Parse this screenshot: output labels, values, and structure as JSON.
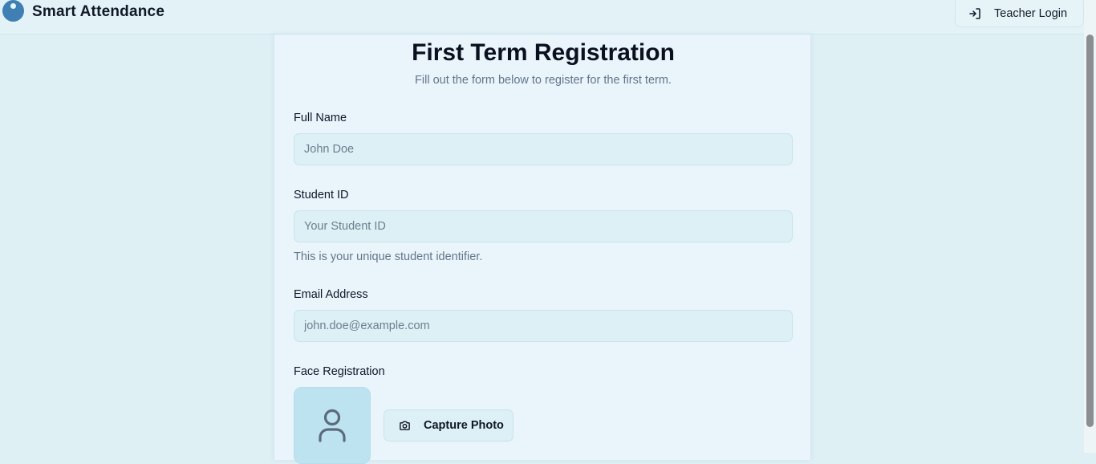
{
  "header": {
    "app_title": "Smart Attendance",
    "logo_icon": "user-circle-logo",
    "login_button": {
      "label": "Teacher Login",
      "icon": "login-arrow-icon"
    }
  },
  "form": {
    "title": "First Term Registration",
    "subtitle": "Fill out the form below to register for the first term.",
    "full_name": {
      "label": "Full Name",
      "placeholder": "John Doe",
      "value": ""
    },
    "student_id": {
      "label": "Student ID",
      "placeholder": "Your Student ID",
      "value": "",
      "helper": "This is your unique student identifier."
    },
    "email": {
      "label": "Email Address",
      "placeholder": "john.doe@example.com",
      "value": ""
    },
    "face_registration": {
      "label": "Face Registration",
      "avatar_icon": "user-placeholder-icon",
      "capture_button": {
        "label": "Capture Photo",
        "icon": "camera-icon"
      }
    }
  },
  "colors": {
    "background": "#dff0f5",
    "card": "#e9f5fa",
    "input": "#dcf0f5",
    "logo": "#3f7fb3",
    "avatar_bg": "#bde3f1"
  }
}
